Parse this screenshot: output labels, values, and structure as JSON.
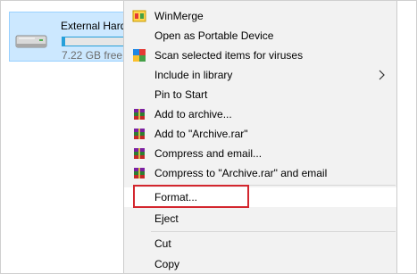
{
  "drive": {
    "name": "External Hard",
    "free_text": "7.22 GB free o",
    "usage_fraction": 0.03,
    "icon": "drive-icon",
    "colors": {
      "tile_bg": "#cce8ff",
      "bar": "#26a0da"
    }
  },
  "menu": {
    "items": [
      {
        "label": "WinMerge",
        "icon": "winmerge-icon"
      },
      {
        "label": "Open as Portable Device",
        "icon": ""
      },
      {
        "label": "Scan selected items for viruses",
        "icon": "antivirus-icon"
      },
      {
        "label": "Include in library",
        "icon": "",
        "submenu": true
      },
      {
        "label": "Pin to Start",
        "icon": ""
      },
      {
        "label": "Add to archive...",
        "icon": "winrar-icon"
      },
      {
        "label": "Add to \"Archive.rar\"",
        "icon": "winrar-icon"
      },
      {
        "label": "Compress and email...",
        "icon": "winrar-icon"
      },
      {
        "label": "Compress to \"Archive.rar\" and email",
        "icon": "winrar-icon"
      },
      {
        "label": "Format...",
        "icon": "",
        "highlighted": true
      },
      {
        "label": "Eject",
        "icon": ""
      },
      {
        "label": "Cut",
        "icon": ""
      },
      {
        "label": "Copy",
        "icon": ""
      }
    ],
    "colors": {
      "background": "#f2f2f2",
      "highlight_border": "#d3262e"
    }
  }
}
